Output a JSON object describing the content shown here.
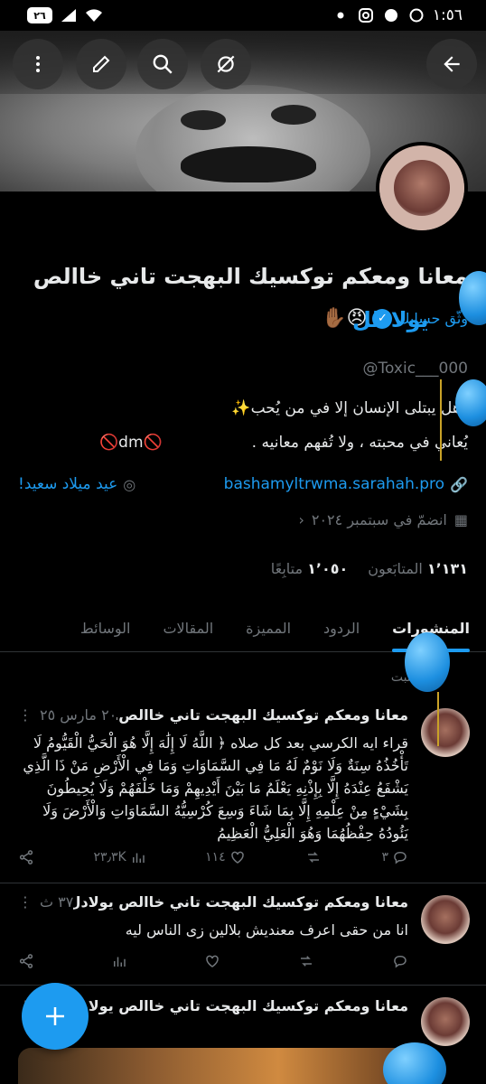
{
  "status_bar": {
    "time": "١:٥٦",
    "battery": "٢٦"
  },
  "header": {
    "back_icon": "arrow-left-icon",
    "nav_icons": [
      "spaces-off-icon",
      "search-icon",
      "edit-icon",
      "more-icon"
    ]
  },
  "profile": {
    "name": "معانا ومعكم توكسيك البهجت تاني خاالص",
    "verify_label": "وثّق حسابك",
    "emojis": "😠✋🏾",
    "handle": "@Toxic___000",
    "bio_line1": "وهل يبتلى الإنسان إلا في من يُحب✨",
    "bio_line2": "يُعاني في محبته ، ولا تُفهم معانيه .",
    "bio_dm": "🚫dm🚫",
    "link": "bashamyltrwma.sarahah.pro",
    "birthday": "عيد ميلاد سعيد!",
    "joined": "انضمّ في سبتمبر ٢٠٢٤",
    "followers_count": "١٬١٣١",
    "followers_label": "المتابَعون",
    "following_count": "١٬٠٥٠",
    "following_label": "متابِعًا",
    "balloon_text": "يولادلل"
  },
  "tabs": [
    {
      "label": "المنشورات",
      "active": true
    },
    {
      "label": "الردود",
      "active": false
    },
    {
      "label": "المميزة",
      "active": false
    },
    {
      "label": "المقالات",
      "active": false
    },
    {
      "label": "الوسائط",
      "active": false
    }
  ],
  "pinned_label": "مُثبت",
  "tweets": [
    {
      "name": "معانا ومعكم توكسيك البهجت تاني خاالص...",
      "meta": "٢٠ مارس ٢٥",
      "body": "قراء ايه الكرسي بعد كل صلاه ﴿ اللَّهُ لَا إِلَٰهَ إِلَّا هُوَ الْحَيُّ الْقَيُّومُ لَا تَأْخُذُهُ سِنَةٌ وَلَا نَوْمٌ لَهُ مَا فِي السَّمَاوَاتِ وَمَا فِي الْأَرْضِ مَنْ ذَا الَّذِي يَشْفَعُ عِنْدَهُ إِلَّا بِإِذْنِهِ يَعْلَمُ مَا بَيْنَ أَيْدِيهِمْ وَمَا خَلْفَهُمْ وَلَا يُحِيطُونَ بِشَيْءٍ مِنْ عِلْمِهِ إِلَّا بِمَا شَاءَ وَسِعَ كُرْسِيُّهُ السَّمَاوَاتِ وَالْأَرْضَ وَلَا يَئُودُهُ حِفْظُهُمَا وَهُوَ الْعَلِيُّ الْعَظِيمُ",
      "replies": "٣",
      "reposts": "",
      "likes": "١١٤",
      "views": "٢٣٫٣K"
    },
    {
      "name": "معانا ومعكم توكسيك البهجت تاني خاالص يولادل...",
      "meta": "٣٧ ث",
      "body": "انا من حقى اعرف معنديش بلالين زى الناس ليه",
      "replies": "",
      "reposts": "",
      "likes": "",
      "views": ""
    },
    {
      "name": "معانا ومعكم توكسيك البهجت تاني خاالص يولادلل...",
      "meta": "",
      "body": "",
      "replies": "",
      "reposts": "",
      "likes": "",
      "views": ""
    }
  ],
  "colors": {
    "accent": "#1d9bf0",
    "background": "#000000",
    "secondary_text": "#71767b"
  }
}
